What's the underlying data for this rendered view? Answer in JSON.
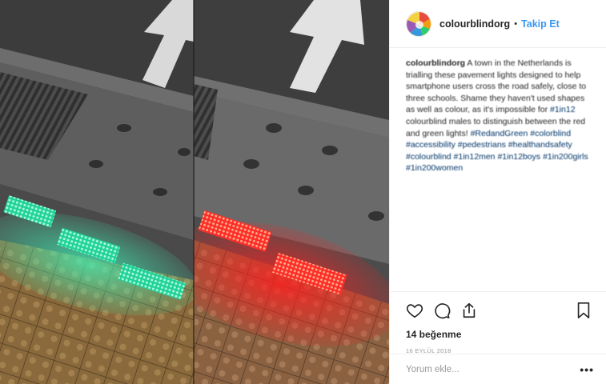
{
  "header": {
    "username": "colourblindorg",
    "separator": "•",
    "follow_label": "Takip Et"
  },
  "caption": {
    "username": "colourblindorg",
    "text_1": "A town in the Netherlands is trialling these pavement lights designed to help smartphone users cross the road safely, close to three schools. Shame they haven't used shapes as well as colour, as it's impossible for",
    "tag_1": "#1in12",
    "text_2": "colourblind males to distinguish between the red and green lights!",
    "hashtags": [
      "#RedandGreen",
      "#colorblind",
      "#accessibility",
      "#pedestrians",
      "#healthandsafety",
      "#colourblind",
      "#1in12men",
      "#1in12boys",
      "#1in200girls",
      "#1in200women"
    ]
  },
  "actions": {
    "icons": [
      "heart-icon",
      "comment-icon",
      "share-icon",
      "bookmark-icon"
    ],
    "likes": "14 beğenme",
    "date": "16 EYLÜL 2018"
  },
  "comment": {
    "placeholder": "Yorum ekle...",
    "more": "•••"
  },
  "colors": {
    "accent": "#3897f0",
    "hashtag": "#003569",
    "light_green": "#2fe3a8",
    "light_red": "#ff2a2a"
  }
}
